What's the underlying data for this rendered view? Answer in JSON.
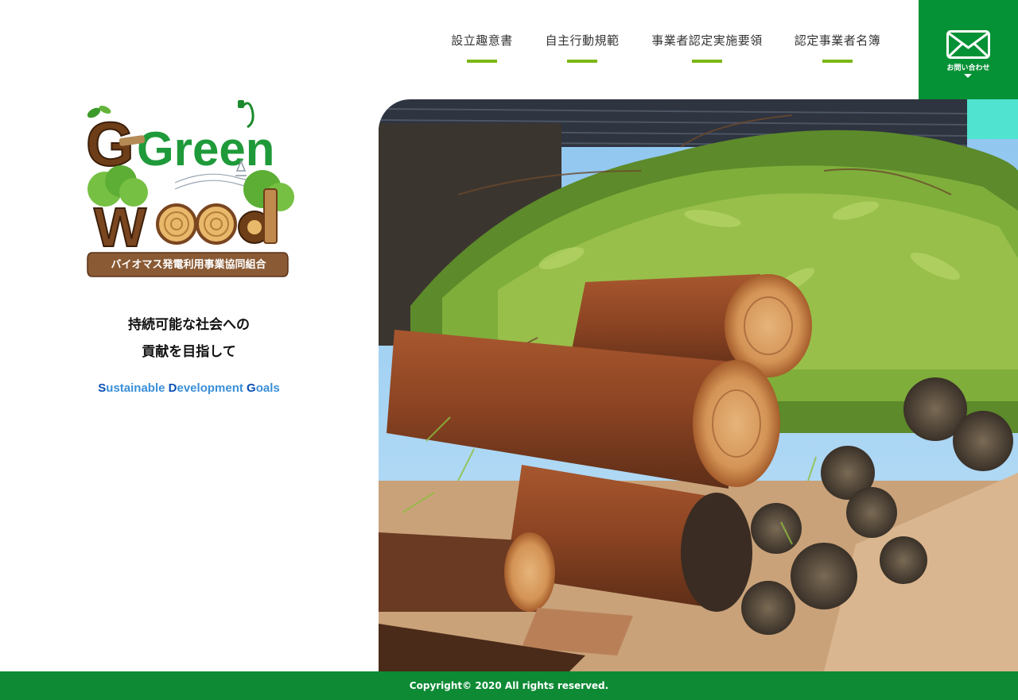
{
  "nav": {
    "items": [
      {
        "label": "設立趣意書"
      },
      {
        "label": "自主行動規範"
      },
      {
        "label": "事業者認定実施要領"
      },
      {
        "label": "認定事業者名簿"
      }
    ]
  },
  "contact": {
    "label": "お問い合わせ"
  },
  "logo": {
    "word1": "Green",
    "word2": "Wood",
    "subtitle": "バイオマス発電利用事業協同組合"
  },
  "tagline": {
    "line1": "持続可能な社会への",
    "line2": "貢献を目指して"
  },
  "sdg": {
    "s": "S",
    "s_rest": "ustainable ",
    "d": "D",
    "d_rest": "evelopment ",
    "g": "G",
    "g_rest": "oals"
  },
  "footer": {
    "copyright": "Copyright© 2020 All rights reserved."
  },
  "colors": {
    "brand_green": "#059135",
    "accent_lime": "#7cb718",
    "footer_green": "#0e8a34",
    "sdg_blue": "#3a8fd8"
  }
}
